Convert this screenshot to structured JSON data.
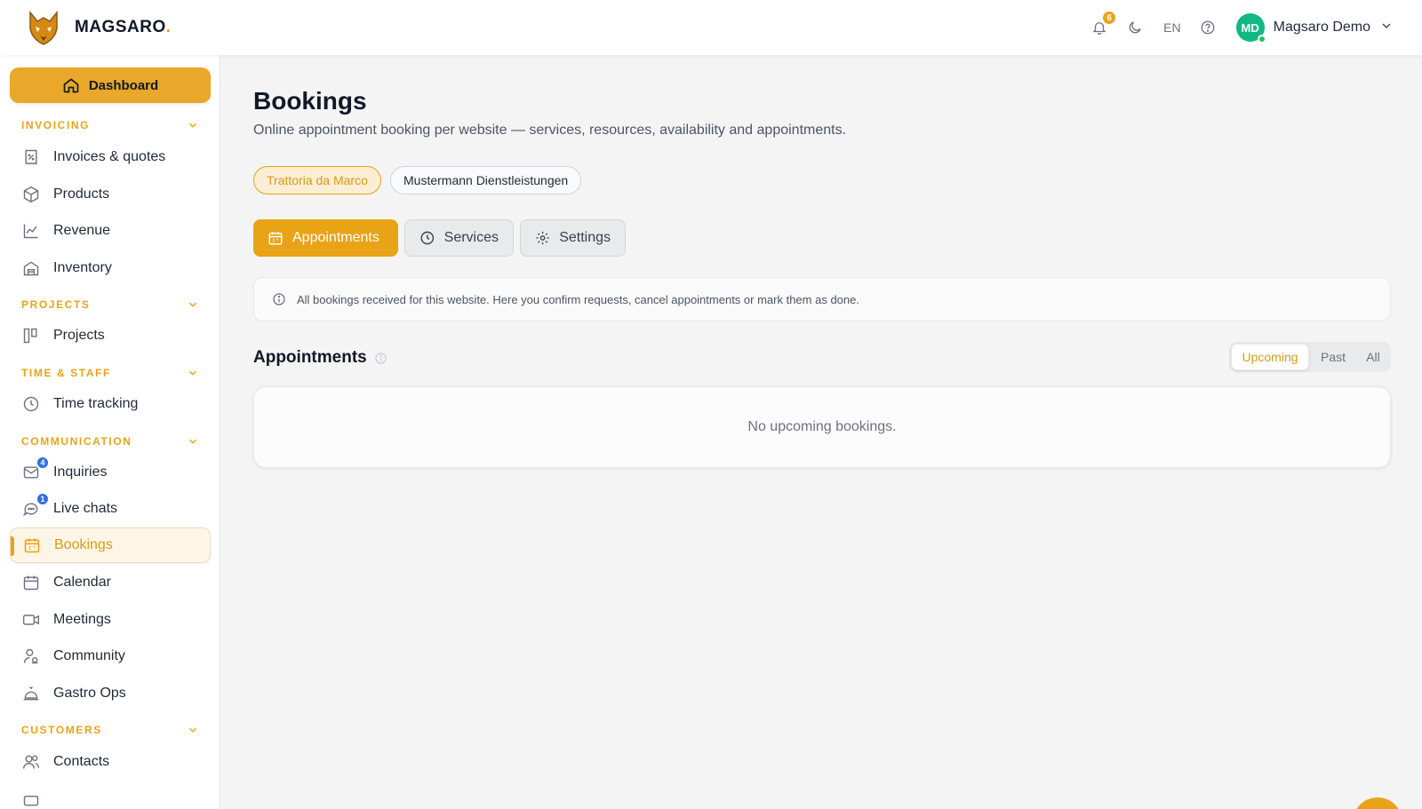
{
  "brand": {
    "name": "MAGSARO",
    "dot": "."
  },
  "topbar": {
    "notifications_count": "6",
    "language": "EN",
    "user_initials": "MD",
    "user_name": "Magsaro Demo"
  },
  "sidebar": {
    "dashboard_label": "Dashboard",
    "sections": {
      "invoicing": "INVOICING",
      "projects": "PROJECTS",
      "time_staff": "TIME & STAFF",
      "communication": "COMMUNICATION",
      "customers": "CUSTOMERS"
    },
    "items": {
      "invoices": "Invoices & quotes",
      "products": "Products",
      "revenue": "Revenue",
      "inventory": "Inventory",
      "projects": "Projects",
      "time_tracking": "Time tracking",
      "inquiries": "Inquiries",
      "inquiries_badge": "4",
      "live_chats": "Live chats",
      "live_chats_badge": "1",
      "bookings": "Bookings",
      "calendar": "Calendar",
      "meetings": "Meetings",
      "community": "Community",
      "gastro_ops": "Gastro Ops",
      "contacts": "Contacts"
    }
  },
  "main": {
    "title": "Bookings",
    "subtitle": "Online appointment booking per website — services, resources, availability and appointments.",
    "websites": [
      "Trattoria da Marco",
      "Mustermann Dienstleistungen"
    ],
    "tabs": {
      "appointments": "Appointments",
      "services": "Services",
      "settings": "Settings"
    },
    "info": "All bookings received for this website. Here you confirm requests, cancel appointments or mark them as done.",
    "appointments_heading": "Appointments",
    "filters": {
      "upcoming": "Upcoming",
      "past": "Past",
      "all": "All"
    },
    "empty_message": "No upcoming bookings."
  },
  "colors": {
    "accent": "#e9a317",
    "online": "#22c55e",
    "badge_blue": "#2f6fe4"
  }
}
